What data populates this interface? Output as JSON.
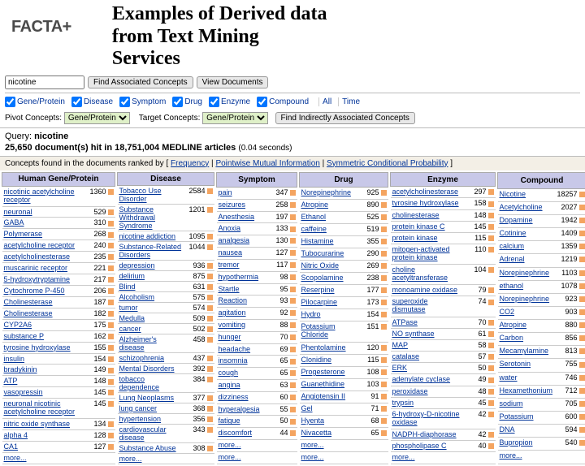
{
  "brand": "FACTA+",
  "title_lines": [
    "Examples of Derived data",
    "from Text Mining",
    "Services"
  ],
  "search": {
    "value": "nicotine"
  },
  "buttons": {
    "find": "Find Associated Concepts",
    "view": "View Documents"
  },
  "filters": [
    "Gene/Protein",
    "Disease",
    "Symptom",
    "Drug",
    "Enzyme",
    "Compound"
  ],
  "all_label": "All",
  "time_label": "Time",
  "pivot": {
    "label": "Pivot Concepts:",
    "value": "Gene/Protein"
  },
  "target": {
    "label": "Target Concepts:",
    "value": "Gene/Protein"
  },
  "indirect_label": "Find Indirectly Associated Concepts",
  "query_prefix": "Query:",
  "query_value": "nicotine",
  "hits_count": "25,650",
  "hits_text": "document(s) hit in 18,751,004 MEDLINE articles",
  "hits_time": "(0.04 seconds)",
  "rank_prefix": "Concepts found in the documents ranked by [",
  "rank_opts": [
    "Frequency",
    "Pointwise Mutual Information",
    "Symmetric Conditional Probability"
  ],
  "more": "more...",
  "columns": [
    {
      "head": "Human Gene/Protein",
      "rows": [
        [
          "nicotinic acetylcholine receptor",
          "1360"
        ],
        [
          "neuronal",
          "529"
        ],
        [
          "GABA",
          "310"
        ],
        [
          "Polymerase",
          "268"
        ],
        [
          "acetylcholine receptor",
          "240"
        ],
        [
          "acetylcholinesterase",
          "235"
        ],
        [
          "muscarinic receptor",
          "221"
        ],
        [
          "5-hydroxytryptamine",
          "217"
        ],
        [
          "Cytochrome P-450",
          "206"
        ],
        [
          "Cholinesterase",
          "187"
        ],
        [
          "Cholinesterase",
          "182"
        ],
        [
          "CYP2A6",
          "175"
        ],
        [
          "substance P",
          "162"
        ],
        [
          "tyrosine hydroxylase",
          "155"
        ],
        [
          "insulin",
          "154"
        ],
        [
          "bradykinin",
          "149"
        ],
        [
          "ATP",
          "148"
        ],
        [
          "vasopressin",
          "145"
        ],
        [
          "neuronal nicotinic acetylcholine receptor",
          "145"
        ],
        [
          "nitric oxide synthase",
          "134"
        ],
        [
          "alpha 4",
          "128"
        ],
        [
          "CA1",
          "127"
        ]
      ]
    },
    {
      "head": "Disease",
      "rows": [
        [
          "Tobacco Use Disorder",
          "2584"
        ],
        [
          "Substance Withdrawal Syndrome",
          "1201"
        ],
        [
          "nicotine addiction",
          "1095"
        ],
        [
          "Substance-Related Disorders",
          "1044"
        ],
        [
          "depression",
          "936"
        ],
        [
          "delirium",
          "875"
        ],
        [
          "Blind",
          "631"
        ],
        [
          "Alcoholism",
          "575"
        ],
        [
          "tumor",
          "574"
        ],
        [
          "Medulla",
          "509"
        ],
        [
          "cancer",
          "502"
        ],
        [
          "Alzheimer's disease",
          "458"
        ],
        [
          "schizophrenia",
          "437"
        ],
        [
          "Mental Disorders",
          "392"
        ],
        [
          "tobacco dependence",
          "384"
        ],
        [
          "Lung Neoplasms",
          "377"
        ],
        [
          "lung cancer",
          "368"
        ],
        [
          "hypertension",
          "356"
        ],
        [
          "cardiovascular disease",
          "343"
        ],
        [
          "Substance Abuse",
          "308"
        ]
      ]
    },
    {
      "head": "Symptom",
      "rows": [
        [
          "pain",
          "347"
        ],
        [
          "seizures",
          "258"
        ],
        [
          "Anesthesia",
          "197"
        ],
        [
          "Anoxia",
          "133"
        ],
        [
          "analgesia",
          "130"
        ],
        [
          "nausea",
          "127"
        ],
        [
          "tremor",
          "117"
        ],
        [
          "hypothermia",
          "98"
        ],
        [
          "Startle",
          "95"
        ],
        [
          "Reaction",
          "93"
        ],
        [
          "agitation",
          "92"
        ],
        [
          "vomiting",
          "88"
        ],
        [
          "hunger",
          "70"
        ],
        [
          "headache",
          "69"
        ],
        [
          "insomnia",
          "65"
        ],
        [
          "cough",
          "65"
        ],
        [
          "angina",
          "63"
        ],
        [
          "dizziness",
          "60"
        ],
        [
          "hyperalgesia",
          "55"
        ],
        [
          "fatigue",
          "50"
        ],
        [
          "discomfort",
          "44"
        ],
        [
          "more...",
          ""
        ]
      ]
    },
    {
      "head": "Drug",
      "rows": [
        [
          "Norepinephrine",
          "925"
        ],
        [
          "Atropine",
          "890"
        ],
        [
          "Ethanol",
          "525"
        ],
        [
          "caffeine",
          "519"
        ],
        [
          "Histamine",
          "355"
        ],
        [
          "Tubocurarine",
          "290"
        ],
        [
          "Nitric Oxide",
          "269"
        ],
        [
          "Scopolamine",
          "238"
        ],
        [
          "Reserpine",
          "177"
        ],
        [
          "Pilocarpine",
          "173"
        ],
        [
          "Hydro",
          "154"
        ],
        [
          "Potassium Chloride",
          "151"
        ],
        [
          "Phentolamine",
          "120"
        ],
        [
          "Clonidine",
          "115"
        ],
        [
          "Progesterone",
          "108"
        ],
        [
          "Guanethidine",
          "103"
        ],
        [
          "Angiotensin II",
          "91"
        ],
        [
          "Gel",
          "71"
        ],
        [
          "Hyenta",
          "68"
        ],
        [
          "Nivacetta",
          "65"
        ],
        [
          "more...",
          ""
        ]
      ]
    },
    {
      "head": "Enzyme",
      "rows": [
        [
          "acetylcholinesterase",
          "297"
        ],
        [
          "tyrosine hydroxylase",
          "158"
        ],
        [
          "cholinesterase",
          "148"
        ],
        [
          "protein kinase C",
          "145"
        ],
        [
          "protein kinase",
          "115"
        ],
        [
          "mitogen-activated protein kinase",
          "110"
        ],
        [
          "choline acetyltransferase",
          "104"
        ],
        [
          "monoamine oxidase",
          "79"
        ],
        [
          "superoxide dismutase",
          "74"
        ],
        [
          "ATPase",
          "70"
        ],
        [
          "NO synthase",
          "61"
        ],
        [
          "MAP",
          "58"
        ],
        [
          "catalase",
          "57"
        ],
        [
          "ERK",
          "50"
        ],
        [
          "adenylate cyclase",
          "49"
        ],
        [
          "peroxidase",
          "48"
        ],
        [
          "trypsin",
          "45"
        ],
        [
          "6-hydroxy-D-nicotine oxidase",
          "42"
        ],
        [
          "NADPH-diaphorase",
          "42"
        ],
        [
          "phospholipase C",
          "40"
        ]
      ]
    },
    {
      "head": "Compound",
      "rows": [
        [
          "Nicotine",
          "18257"
        ],
        [
          "Acetylcholine",
          "2027"
        ],
        [
          "Dopamine",
          "1942"
        ],
        [
          "Cotinine",
          "1409"
        ],
        [
          "calcium",
          "1359"
        ],
        [
          "Adrenal",
          "1219"
        ],
        [
          "Norepinephrine",
          "1103"
        ],
        [
          "ethanol",
          "1078"
        ],
        [
          "Norepinephrine",
          "923"
        ],
        [
          "CO2",
          "903"
        ],
        [
          "Atropine",
          "880"
        ],
        [
          "Carbon",
          "856"
        ],
        [
          "Mecamylamine",
          "813"
        ],
        [
          "Serotonin",
          "755"
        ],
        [
          "water",
          "746"
        ],
        [
          "Hexamethonium",
          "712"
        ],
        [
          "sodium",
          "705"
        ],
        [
          "Potassium",
          "600"
        ],
        [
          "DNA",
          "594"
        ],
        [
          "Bupropion",
          "540"
        ]
      ]
    }
  ]
}
